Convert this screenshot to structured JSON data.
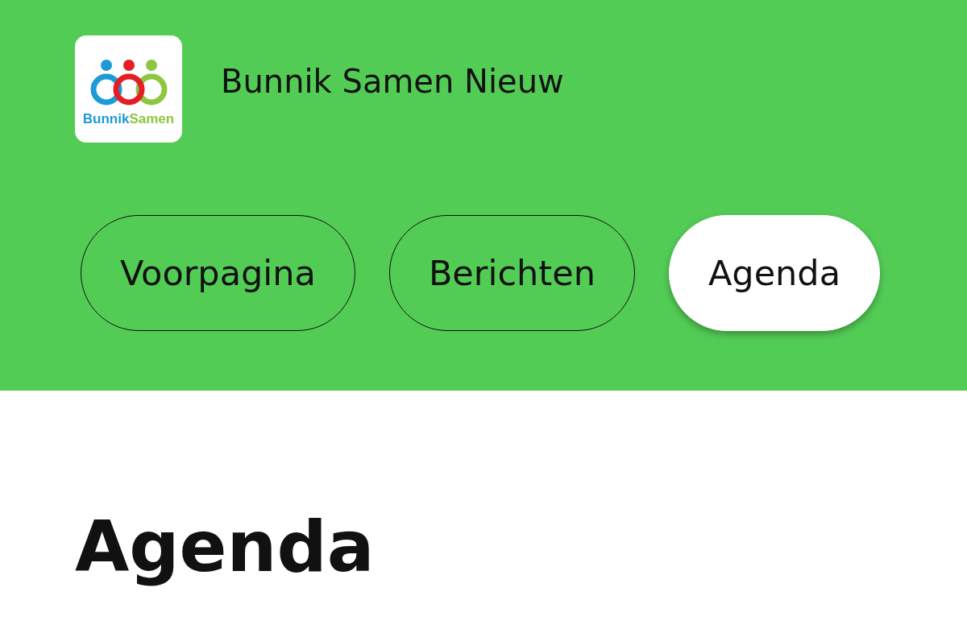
{
  "header": {
    "logo": {
      "words": [
        {
          "text": "Bunnik",
          "color": "#1e9ad6"
        },
        {
          "text": "Samen",
          "color": "#8dc63f"
        }
      ]
    },
    "site_title": "Bunnik Samen Nieuw"
  },
  "nav": [
    {
      "label": "Voorpagina",
      "selected": false
    },
    {
      "label": "Berichten",
      "selected": false
    },
    {
      "label": "Agenda",
      "selected": true
    }
  ],
  "page_title": "Agenda"
}
